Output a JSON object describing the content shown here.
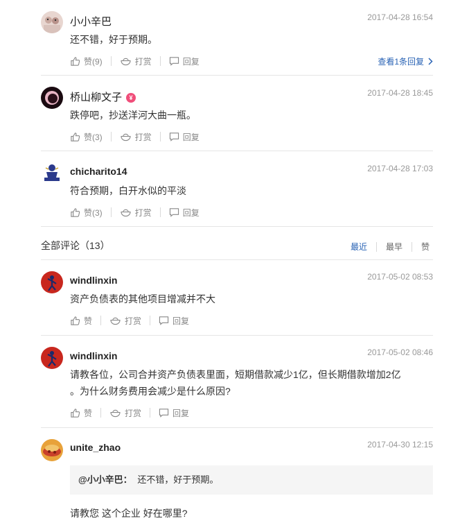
{
  "comments_top": [
    {
      "username": "小小辛巴",
      "timestamp": "2017-04-28 16:54",
      "text": "还不错，好于预期。",
      "like_label": "赞(9)",
      "reward_label": "打赏",
      "reply_label": "回复",
      "view_replies": "查看1条回复"
    },
    {
      "username": "桥山柳文子",
      "badge": "¥",
      "timestamp": "2017-04-28 18:45",
      "text": "跌停吧，抄送洋河大曲一瓶。",
      "like_label": "赞(3)",
      "reward_label": "打赏",
      "reply_label": "回复"
    },
    {
      "username": "chicharito14",
      "timestamp": "2017-04-28 17:03",
      "text": "符合预期，白开水似的平淡",
      "like_label": "赞(3)",
      "reward_label": "打赏",
      "reply_label": "回复"
    }
  ],
  "all_comments": {
    "title": "全部评论（13）",
    "sort_tabs": [
      "最近",
      "最早",
      "赞"
    ],
    "active_sort": "最近"
  },
  "comments_all": [
    {
      "username": "windlinxin",
      "timestamp": "2017-05-02 08:53",
      "text": "资产负债表的其他项目增减并不大",
      "like_label": "赞",
      "reward_label": "打赏",
      "reply_label": "回复"
    },
    {
      "username": "windlinxin",
      "timestamp": "2017-05-02 08:46",
      "text_line1": "请教各位，公司合并资产负债表里面，短期借款减少1亿，但长期借款增加2亿",
      "text_line2": "。为什么财务费用会减少是什么原因?",
      "like_label": "赞",
      "reward_label": "打赏",
      "reply_label": "回复"
    },
    {
      "username": "unite_zhao",
      "timestamp": "2017-04-30 12:15",
      "quote_user": "@小小辛巴：",
      "quote_text": "还不错，好于预期。",
      "text": "请教您 这个企业 好在哪里?"
    }
  ],
  "colors": {
    "link": "#2862b4",
    "muted": "#999999",
    "divider": "#e5e5e5",
    "badge": "#f04e7a"
  },
  "icons": [
    "thumbs-up-icon",
    "reward-bowl-icon",
    "reply-bubble-icon",
    "chevron-right-icon",
    "verified-badge-icon"
  ]
}
